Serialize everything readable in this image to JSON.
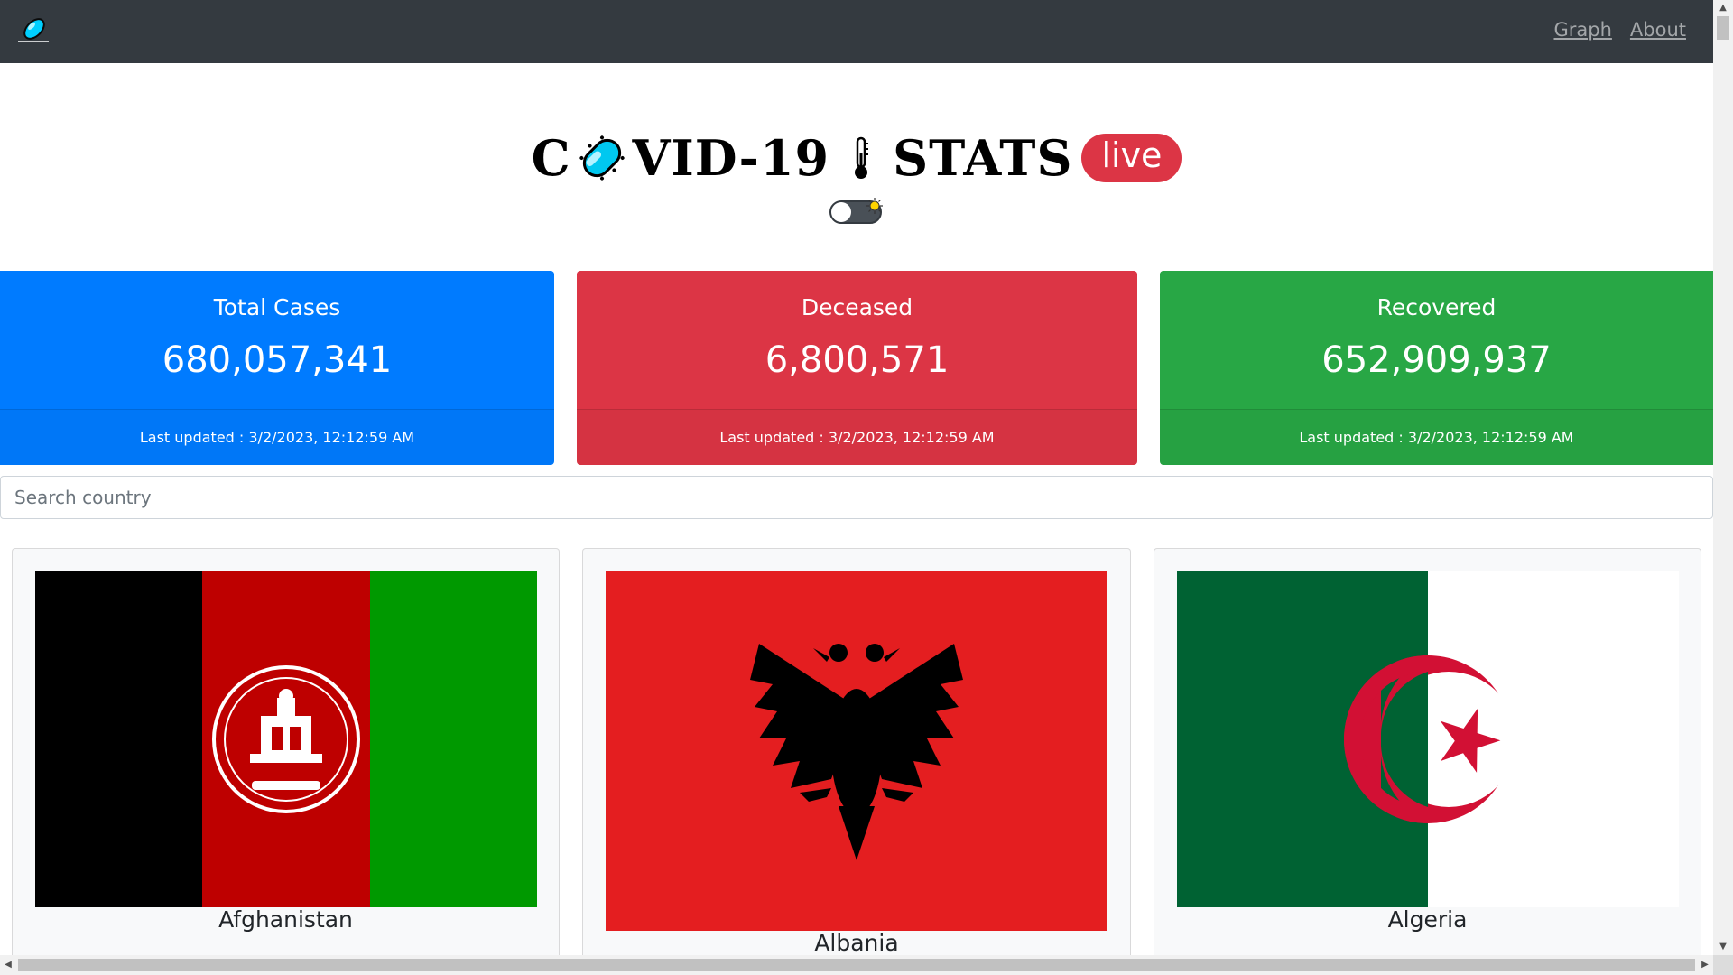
{
  "navbar": {
    "logo_icon": "virus-capsule-icon",
    "links": [
      {
        "label": "Graph"
      },
      {
        "label": "About"
      }
    ]
  },
  "header": {
    "title_c": "C",
    "title_rest": "VID-19",
    "title_stats": "STATS",
    "live_badge": "live",
    "theme_toggle_icon": "sun-icon"
  },
  "stats": [
    {
      "title": "Total Cases",
      "value": "680,057,341",
      "footer": "Last updated : 3/2/2023, 12:12:59 AM",
      "color": "#007bff"
    },
    {
      "title": "Deceased",
      "value": "6,800,571",
      "footer": "Last updated : 3/2/2023, 12:12:59 AM",
      "color": "#dc3545"
    },
    {
      "title": "Recovered",
      "value": "652,909,937",
      "footer": "Last updated : 3/2/2023, 12:12:59 AM",
      "color": "#28a745"
    }
  ],
  "search": {
    "placeholder": "Search country",
    "value": ""
  },
  "countries": [
    {
      "name": "Afghanistan",
      "flag": "afghanistan-flag"
    },
    {
      "name": "Albania",
      "flag": "albania-flag"
    },
    {
      "name": "Algeria",
      "flag": "algeria-flag"
    }
  ]
}
